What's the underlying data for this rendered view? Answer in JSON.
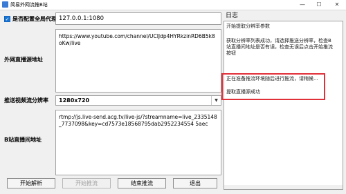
{
  "window": {
    "title": "简易外网流推B站",
    "minimize": "—",
    "maximize": "☐",
    "close": "✕"
  },
  "proxy": {
    "checkbox_label": "是否配置全局代理",
    "checked": true,
    "value": "127.0.0.1:1080"
  },
  "source": {
    "label": "外网直播源地址",
    "value": "https://www.youtube.com/channel/UCIJdp4HYRkzinRD6B5k8oKw/live"
  },
  "resolution": {
    "label": "推送视频流分辨率",
    "selected": "1280x720"
  },
  "bilibili": {
    "label": "B站直播间地址",
    "value": "rtmp://js.live-send.acg.tv/live-js/?streamname=live_2335148_7737098&key=cd7573e18568795dab2952234554 5aec"
  },
  "buttons": {
    "parse": "开始解析",
    "push": "开始推流",
    "stop": "结束推流",
    "exit": "退出"
  },
  "log": {
    "title": "日志",
    "lines": [
      "开始提取分辨率参数",
      "获取分辨率列表成功，请选择推送分辨率，检查B",
      "站直播间地址是否有误，检查无误后点击开始推流",
      "按钮",
      "正在准备推流环境随后进行推流，请稍候...",
      "提取直播源成功"
    ]
  },
  "colors": {
    "accent": "#1976d2",
    "highlight": "#e0303a"
  }
}
